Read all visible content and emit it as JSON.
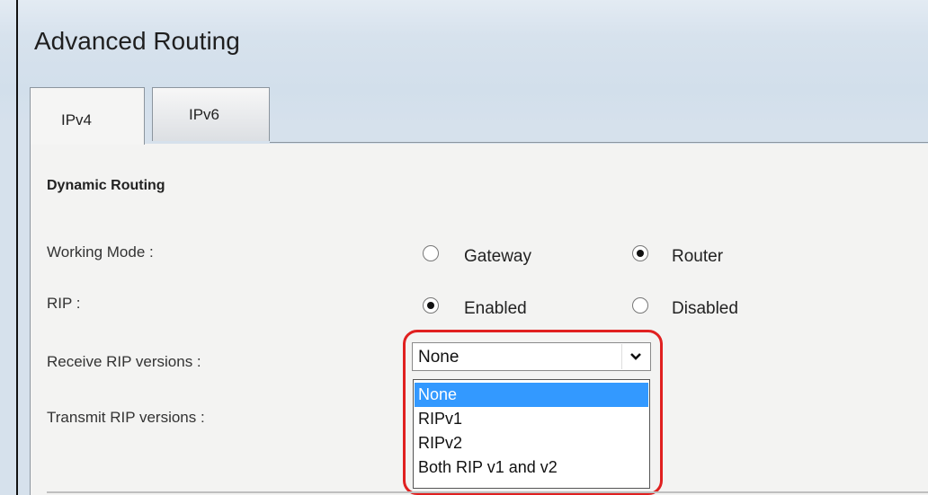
{
  "page": {
    "title": "Advanced Routing"
  },
  "tabs": [
    {
      "label": "IPv4",
      "active": true
    },
    {
      "label": "IPv6",
      "active": false
    }
  ],
  "section": {
    "title": "Dynamic Routing"
  },
  "working_mode": {
    "label": "Working Mode :",
    "options": [
      {
        "label": "Gateway",
        "checked": false
      },
      {
        "label": "Router",
        "checked": true
      }
    ]
  },
  "rip": {
    "label": "RIP :",
    "options": [
      {
        "label": "Enabled",
        "checked": true
      },
      {
        "label": "Disabled",
        "checked": false
      }
    ]
  },
  "receive_rip": {
    "label": "Receive RIP versions :",
    "selected": "None",
    "options": [
      "None",
      "RIPv1",
      "RIPv2",
      "Both RIP v1 and v2"
    ],
    "highlighted_index": 0
  },
  "transmit_rip": {
    "label": "Transmit RIP versions :"
  },
  "colors": {
    "highlight_ring": "#e02020",
    "option_highlight": "#3399ff"
  }
}
